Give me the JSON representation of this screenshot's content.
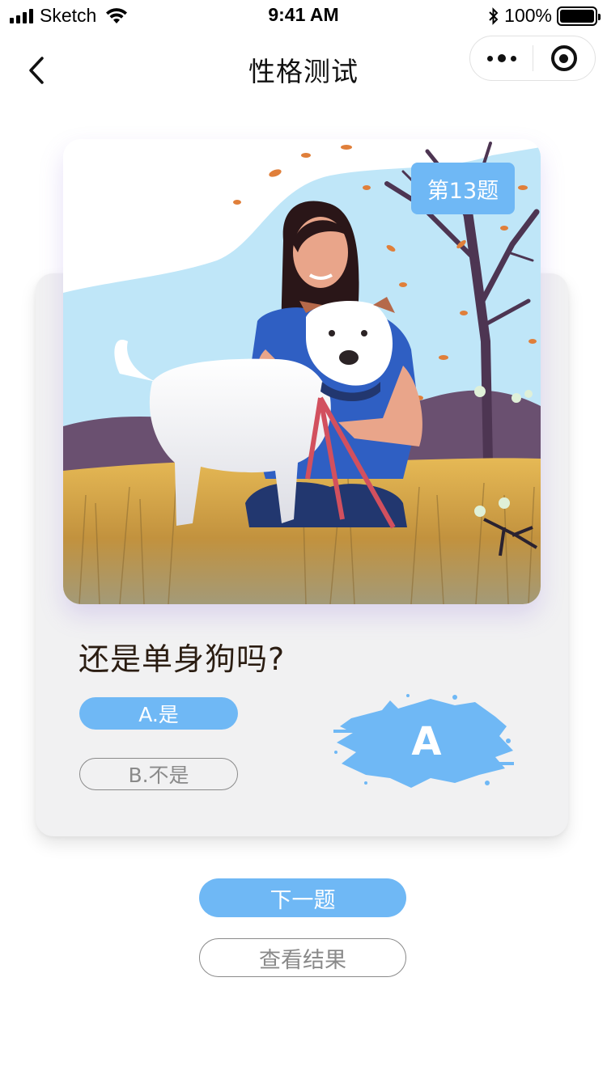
{
  "status_bar": {
    "carrier": "Sketch",
    "time": "9:41 AM",
    "battery": "100%"
  },
  "nav": {
    "title": "性格测试",
    "back_icon": "chevron-left-icon",
    "more_icon": "more-dots-icon",
    "close_icon": "target-circle-icon"
  },
  "quiz": {
    "badge": "第13题",
    "question": "还是单身狗吗?",
    "options": [
      {
        "label": "A.是",
        "selected": true
      },
      {
        "label": "B.不是",
        "selected": false
      }
    ],
    "selected_answer": "A"
  },
  "actions": {
    "next_label": "下一题",
    "result_label": "查看结果"
  },
  "colors": {
    "accent": "#6fb8f5",
    "card_bg": "#f1f1f2",
    "muted": "#8a8a8a"
  }
}
